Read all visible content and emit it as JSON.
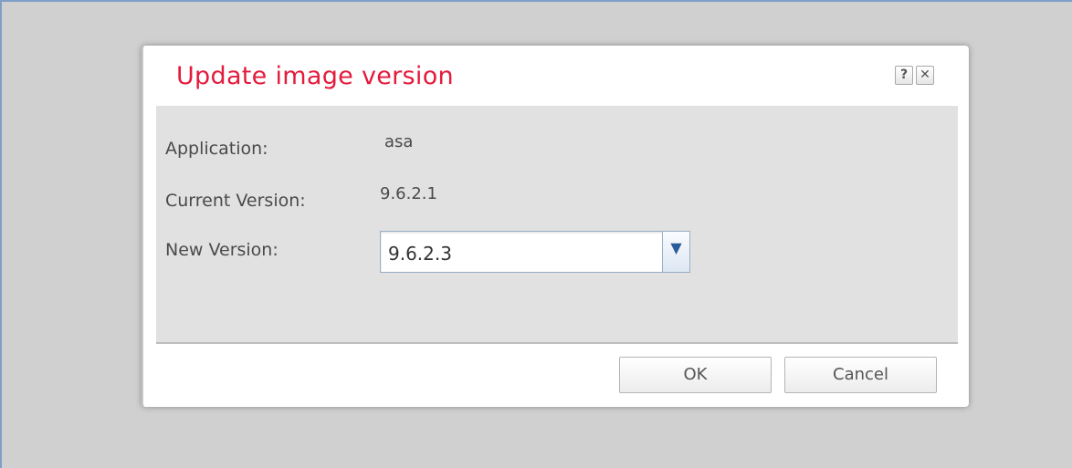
{
  "dialog": {
    "title": "Update image version",
    "help_label": "?",
    "close_label": "✕"
  },
  "fields": {
    "application_label": "Application:",
    "application_value": "asa",
    "current_version_label": "Current Version:",
    "current_version_value": "9.6.2.1",
    "new_version_label": "New Version:",
    "new_version_selected": "9.6.2.3"
  },
  "buttons": {
    "ok_label": "OK",
    "cancel_label": "Cancel"
  },
  "icons": {
    "dropdown": "chevron-down-icon",
    "help": "help-icon",
    "close": "close-icon"
  },
  "colors": {
    "title": "#e31b3d",
    "backdrop": "#d0d0d0",
    "body": "#e1e1e1"
  }
}
